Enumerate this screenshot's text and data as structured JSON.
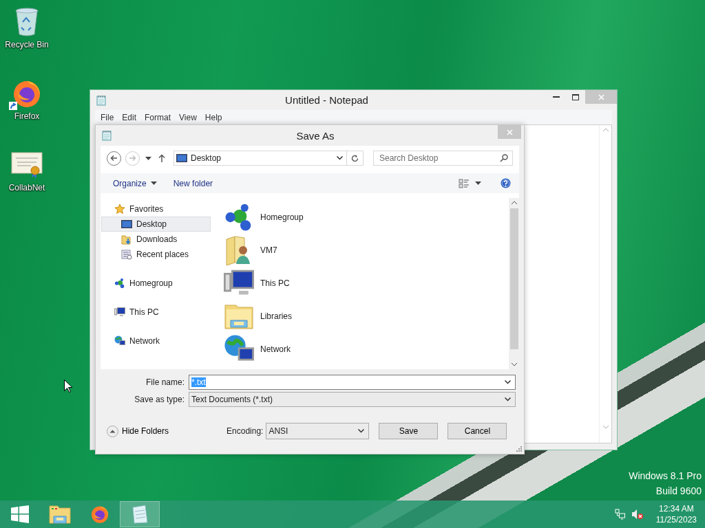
{
  "desktop_icons": [
    {
      "label": "Recycle Bin",
      "kind": "recycle-bin"
    },
    {
      "label": "Firefox",
      "kind": "firefox"
    },
    {
      "label": "CollabNet",
      "kind": "certificate"
    }
  ],
  "notepad": {
    "title": "Untitled - Notepad",
    "menu": [
      "File",
      "Edit",
      "Format",
      "View",
      "Help"
    ]
  },
  "save_dialog": {
    "title": "Save As",
    "address": "Desktop",
    "search": {
      "placeholder": "Search Desktop"
    },
    "commands": [
      {
        "label": "Organize",
        "kind": "menu"
      },
      {
        "label": "New folder",
        "kind": "plain"
      }
    ],
    "nav": [
      {
        "label": "Favorites",
        "kind": "star",
        "selected": false,
        "children": [
          {
            "label": "Desktop",
            "kind": "desktop",
            "selected": true
          },
          {
            "label": "Downloads",
            "kind": "downloads",
            "selected": false
          },
          {
            "label": "Recent places",
            "kind": "recent",
            "selected": false
          }
        ]
      },
      {
        "label": "Homegroup",
        "kind": "homegroup",
        "selected": false
      },
      {
        "label": "This PC",
        "kind": "pc",
        "selected": false
      },
      {
        "label": "Network",
        "kind": "network",
        "selected": false
      }
    ],
    "items": [
      {
        "label": "Homegroup",
        "kind": "homegroup"
      },
      {
        "label": "VM7",
        "kind": "user-folder"
      },
      {
        "label": "This PC",
        "kind": "pc"
      },
      {
        "label": "Libraries",
        "kind": "libraries"
      },
      {
        "label": "Network",
        "kind": "network"
      }
    ],
    "file_name": {
      "label": "File name:",
      "value": "*.txt",
      "value_selected": true
    },
    "save_as_type": {
      "label": "Save as type:",
      "value": "Text Documents (*.txt)"
    },
    "hide_folders": "Hide Folders",
    "encoding": {
      "label": "Encoding:",
      "value": "ANSI"
    },
    "buttons": [
      "Save",
      "Cancel"
    ]
  },
  "os_version": [
    "Windows 8.1 Pro",
    "Build 9600"
  ],
  "taskbar": {
    "apps": [
      {
        "kind": "start",
        "selected": false
      },
      {
        "kind": "explorer",
        "selected": false
      },
      {
        "kind": "firefox",
        "selected": false
      },
      {
        "kind": "notepad",
        "selected": true
      }
    ],
    "tray": [
      {
        "kind": "network"
      },
      {
        "kind": "volume-muted"
      }
    ],
    "clock": {
      "time": "12:34 AM",
      "date": "11/25/2023"
    }
  }
}
